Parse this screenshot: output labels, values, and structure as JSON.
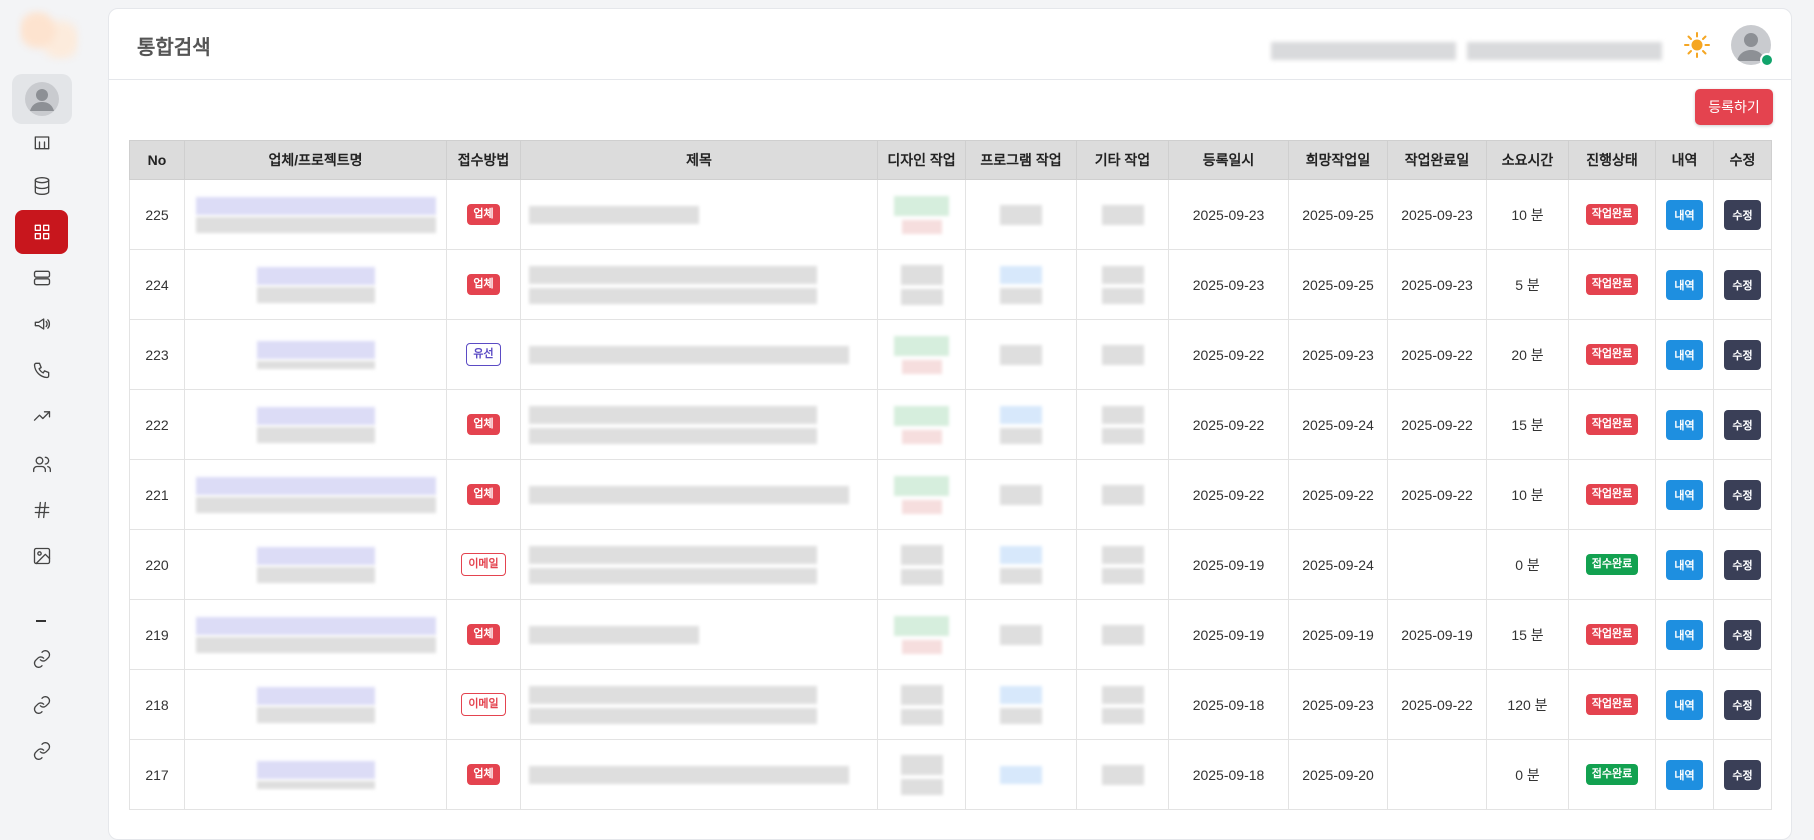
{
  "page": {
    "title": "통합검색"
  },
  "actions": {
    "register_label": "등록하기"
  },
  "colors": {
    "primary_red": "#c8161d",
    "button_red": "#e4434f",
    "blue": "#1e8fe0",
    "dark": "#3a3f57",
    "green": "#12a150"
  },
  "sidebar": {
    "icons": [
      "avatar-icon",
      "building-icon",
      "database-icon",
      "grid-icon",
      "server-icon",
      "megaphone-icon",
      "phone-icon",
      "trending-up-icon",
      "users-icon",
      "hash-icon",
      "image-icon",
      "link-icon",
      "link-icon",
      "link-icon"
    ],
    "active": "grid-icon"
  },
  "table": {
    "columns": [
      "No",
      "업체/프로젝트명",
      "접수방법",
      "제목",
      "디자인 작업",
      "프로그램 작업",
      "기타 작업",
      "등록일시",
      "희망작업일",
      "작업완료일",
      "소요시간",
      "진행상태",
      "내역",
      "수정"
    ],
    "rows": [
      {
        "no": "225",
        "method": "업체",
        "method_style": "red",
        "registered": "2025-09-23",
        "desired": "2025-09-25",
        "completed": "2025-09-23",
        "duration": "10 분",
        "status": "작업완료",
        "status_style": "red",
        "detail": "내역",
        "edit": "수정"
      },
      {
        "no": "224",
        "method": "업체",
        "method_style": "red",
        "registered": "2025-09-23",
        "desired": "2025-09-25",
        "completed": "2025-09-23",
        "duration": "5 분",
        "status": "작업완료",
        "status_style": "red",
        "detail": "내역",
        "edit": "수정"
      },
      {
        "no": "223",
        "method": "유선",
        "method_style": "outline-purple",
        "registered": "2025-09-22",
        "desired": "2025-09-23",
        "completed": "2025-09-22",
        "duration": "20 분",
        "status": "작업완료",
        "status_style": "red",
        "detail": "내역",
        "edit": "수정"
      },
      {
        "no": "222",
        "method": "업체",
        "method_style": "red",
        "registered": "2025-09-22",
        "desired": "2025-09-24",
        "completed": "2025-09-22",
        "duration": "15 분",
        "status": "작업완료",
        "status_style": "red",
        "detail": "내역",
        "edit": "수정"
      },
      {
        "no": "221",
        "method": "업체",
        "method_style": "red",
        "registered": "2025-09-22",
        "desired": "2025-09-22",
        "completed": "2025-09-22",
        "duration": "10 분",
        "status": "작업완료",
        "status_style": "red",
        "detail": "내역",
        "edit": "수정"
      },
      {
        "no": "220",
        "method": "이메일",
        "method_style": "outline-red",
        "registered": "2025-09-19",
        "desired": "2025-09-24",
        "completed": "",
        "duration": "0 분",
        "status": "접수완료",
        "status_style": "green",
        "detail": "내역",
        "edit": "수정"
      },
      {
        "no": "219",
        "method": "업체",
        "method_style": "red",
        "registered": "2025-09-19",
        "desired": "2025-09-19",
        "completed": "2025-09-19",
        "duration": "15 분",
        "status": "작업완료",
        "status_style": "red",
        "detail": "내역",
        "edit": "수정"
      },
      {
        "no": "218",
        "method": "이메일",
        "method_style": "outline-red",
        "registered": "2025-09-18",
        "desired": "2025-09-23",
        "completed": "2025-09-22",
        "duration": "120 분",
        "status": "작업완료",
        "status_style": "red",
        "detail": "내역",
        "edit": "수정"
      },
      {
        "no": "217",
        "method": "업체",
        "method_style": "red",
        "registered": "2025-09-18",
        "desired": "2025-09-20",
        "completed": "",
        "duration": "0 분",
        "status": "접수완료",
        "status_style": "green",
        "detail": "내역",
        "edit": "수정"
      }
    ]
  }
}
